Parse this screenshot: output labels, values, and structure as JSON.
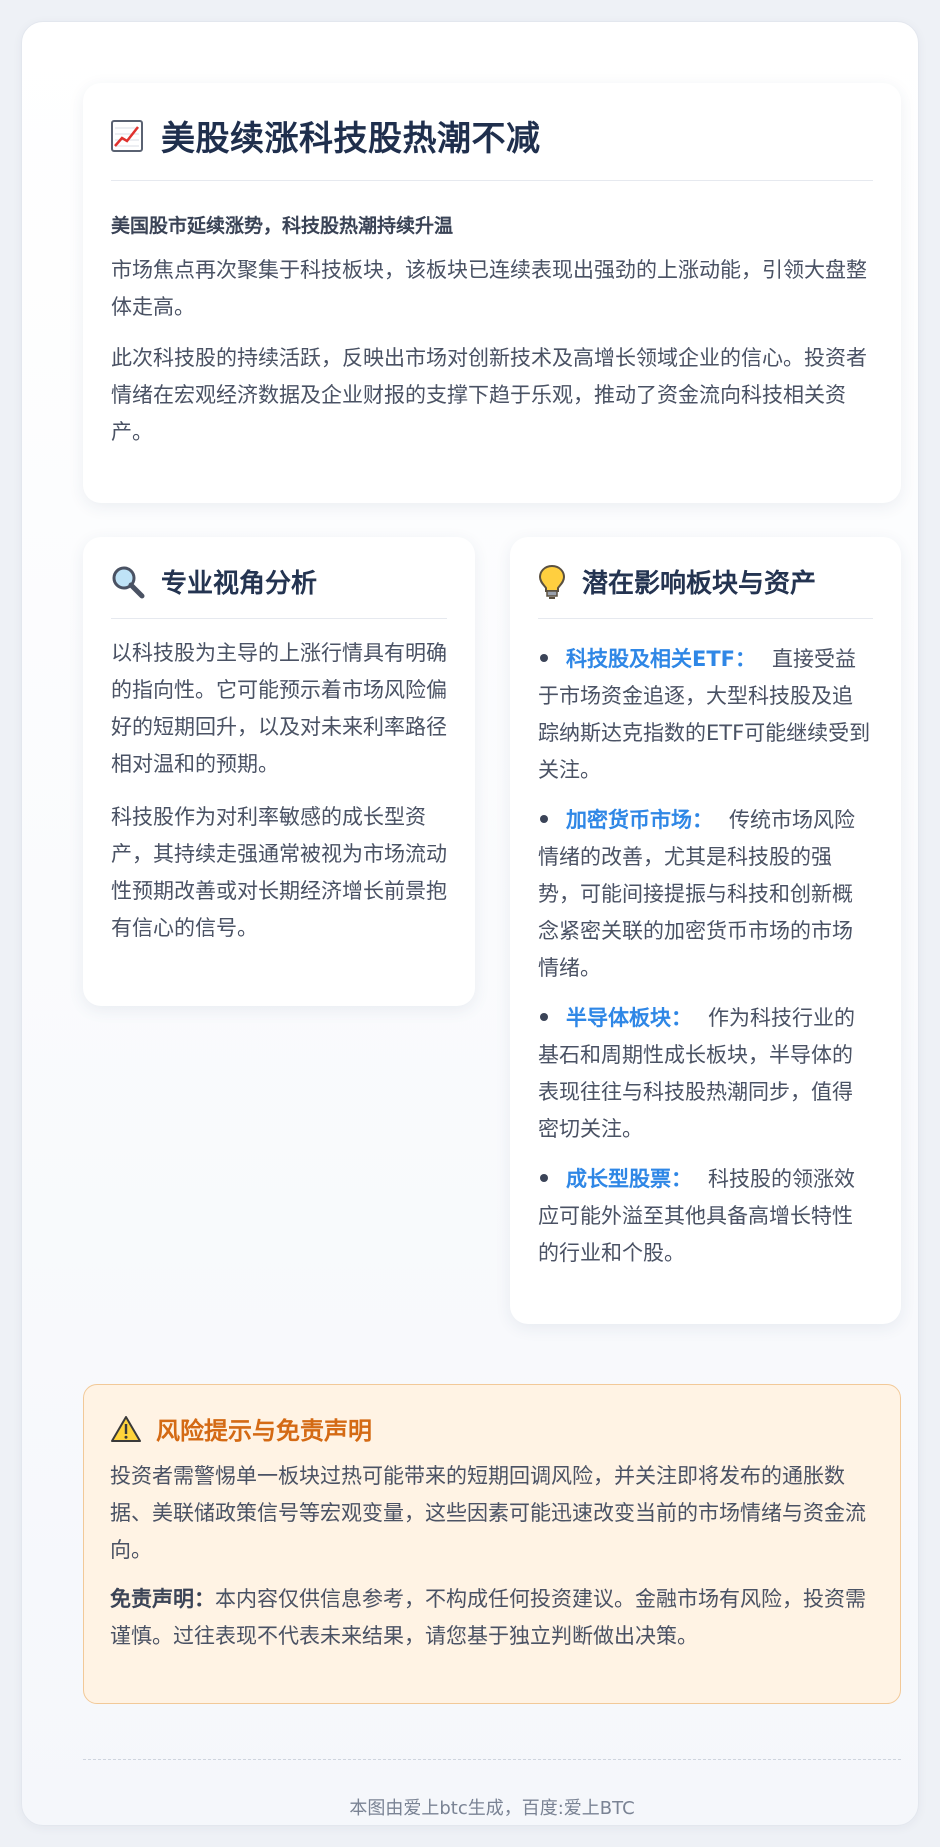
{
  "header": {
    "icon": "chart-increasing-icon",
    "title": "美股续涨科技股热潮不减",
    "subhead": "美国股市延续涨势，科技股热潮持续升温",
    "paragraphs": [
      "市场焦点再次聚集于科技板块，该板块已连续表现出强劲的上涨动能，引领大盘整体走高。",
      "此次科技股的持续活跃，反映出市场对创新技术及高增长领域企业的信心。投资者情绪在宏观经济数据及企业财报的支撑下趋于乐观，推动了资金流向科技相关资产。"
    ]
  },
  "analysis": {
    "icon": "magnifier-icon",
    "title": "专业视角分析",
    "paragraphs": [
      "以科技股为主导的上涨行情具有明确的指向性。它可能预示着市场风险偏好的短期回升，以及对未来利率路径相对温和的预期。",
      "科技股作为对利率敏感的成长型资产，其持续走强通常被视为市场流动性预期改善或对长期经济增长前景抱有信心的信号。"
    ]
  },
  "impact": {
    "icon": "lightbulb-icon",
    "title": "潜在影响板块与资产",
    "items": [
      {
        "label": "科技股及相关ETF：",
        "text": "直接受益于市场资金追逐，大型科技股及追踪纳斯达克指数的ETF可能继续受到关注。"
      },
      {
        "label": "加密货币市场：",
        "text": "传统市场风险情绪的改善，尤其是科技股的强势，可能间接提振与科技和创新概念紧密关联的加密货币市场的市场情绪。"
      },
      {
        "label": "半导体板块：",
        "text": "作为科技行业的基石和周期性成长板块，半导体的表现往往与科技股热潮同步，值得密切关注。"
      },
      {
        "label": "成长型股票：",
        "text": "科技股的领涨效应可能外溢至其他具备高增长特性的行业和个股。"
      }
    ]
  },
  "risk": {
    "icon": "warning-icon",
    "title": "风险提示与免责声明",
    "paragraph": "投资者需警惕单一板块过热可能带来的短期回调风险，并关注即将发布的通胀数据、美联储政策信号等宏观变量，这些因素可能迅速改变当前的市场情绪与资金流向。",
    "disclaimer_label": "免责声明：",
    "disclaimer_text": "本内容仅供信息参考，不构成任何投资建议。金融市场有风险，投资需谨慎。过往表现不代表未来结果，请您基于独立判断做出决策。"
  },
  "footer": {
    "text": "本图由爱上btc生成，百度:爱上BTC"
  },
  "colors": {
    "accent_blue": "#2f87e6",
    "warning_orange": "#d46a14",
    "title_navy": "#1f2f4d"
  }
}
